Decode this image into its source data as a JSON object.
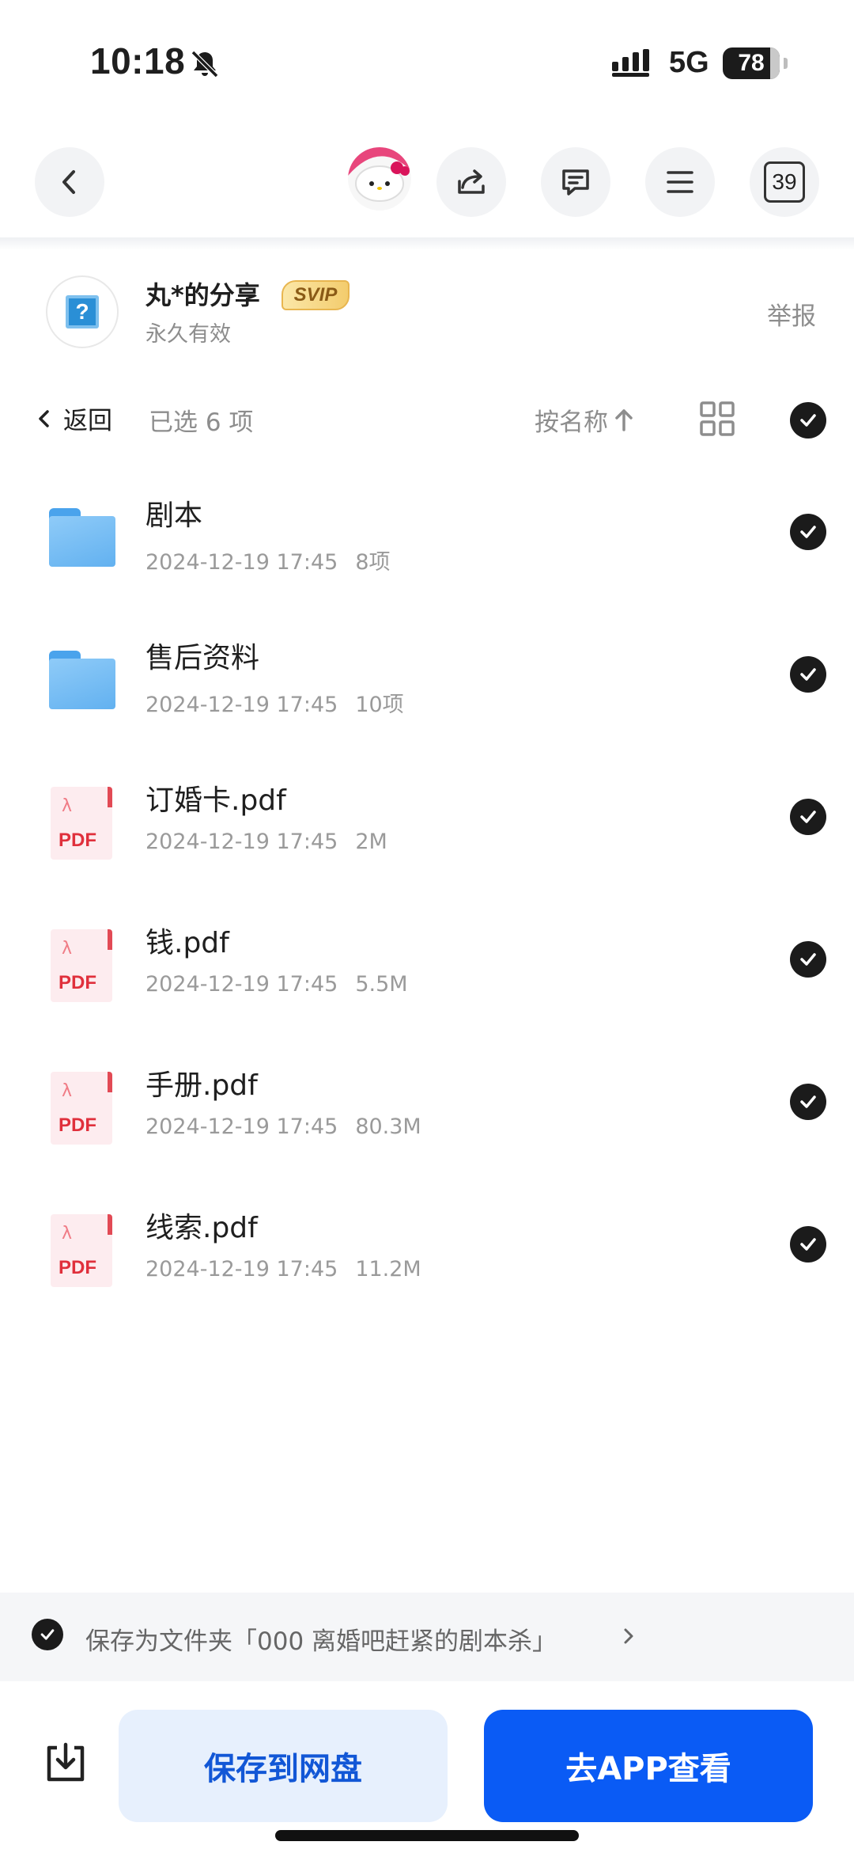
{
  "status_bar": {
    "time": "10:18",
    "network": "5G",
    "battery": "78"
  },
  "nav": {
    "tab_count": "39"
  },
  "share": {
    "title": "丸*的分享",
    "badge": "SVIP",
    "validity": "永久有效",
    "report": "举报"
  },
  "toolbar": {
    "back": "返回",
    "selected": "已选 6 项",
    "sort": "按名称"
  },
  "files": [
    {
      "name": "剧本",
      "date": "2024-12-19 17:45",
      "info": "8项"
    },
    {
      "name": "售后资料",
      "date": "2024-12-19 17:45",
      "info": "10项"
    },
    {
      "name": "订婚卡.pdf",
      "date": "2024-12-19 17:45",
      "info": "2M"
    },
    {
      "name": "钱.pdf",
      "date": "2024-12-19 17:45",
      "info": "5.5M"
    },
    {
      "name": "手册.pdf",
      "date": "2024-12-19 17:45",
      "info": "80.3M"
    },
    {
      "name": "线索.pdf",
      "date": "2024-12-19 17:45",
      "info": "11.2M"
    }
  ],
  "file_icon_types": [
    "folder",
    "folder",
    "pdf",
    "pdf",
    "pdf",
    "pdf"
  ],
  "pdf_icon_label": "PDF",
  "save_as": {
    "text": "保存为文件夹「000 离婚吧赶紧的剧本杀」"
  },
  "actions": {
    "save": "保存到网盘",
    "open_app": "去APP查看"
  },
  "colors": {
    "primary": "#0a5bf5",
    "save_bg": "#e7f0fd",
    "check": "#1b1b1b"
  }
}
